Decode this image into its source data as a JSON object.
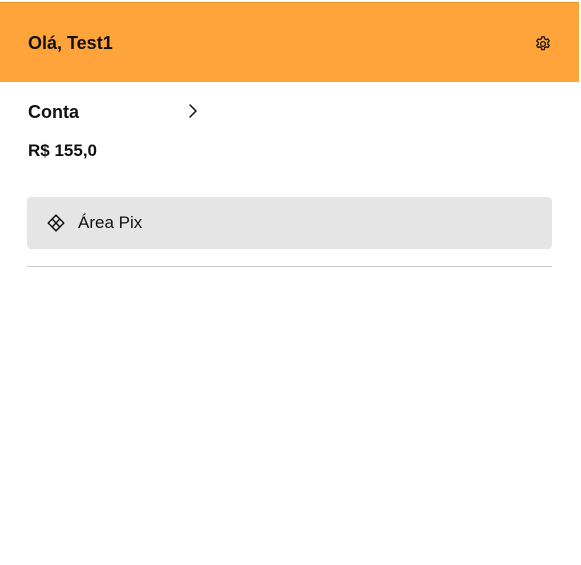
{
  "header": {
    "greeting": "Olá, Test1",
    "settings_icon": "gear-icon",
    "background_color": "#ffa43a"
  },
  "account": {
    "label": "Conta",
    "chevron_icon": "chevron-right-icon",
    "balance": "R$ 155,0"
  },
  "pix": {
    "label": "Área Pix",
    "icon": "pix-icon",
    "background_color": "#e5e5e5"
  }
}
